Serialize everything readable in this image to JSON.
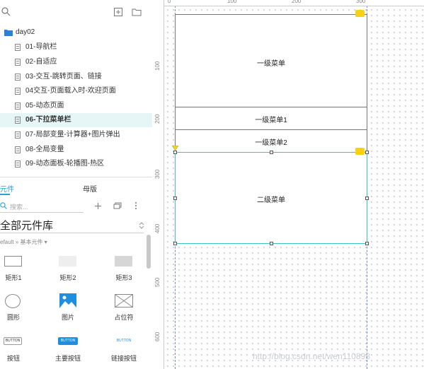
{
  "pages": {
    "folder": "day02",
    "items": [
      {
        "label": "01-导航栏"
      },
      {
        "label": "02-自适应"
      },
      {
        "label": "03-交互-跳转页面、链接"
      },
      {
        "label": "04交互-页面载入时-欢迎页面"
      },
      {
        "label": "05-动态页面"
      },
      {
        "label": "06-下拉菜单栏",
        "selected": true
      },
      {
        "label": "07-局部变量-计算器+图片弹出"
      },
      {
        "label": "08-全局变量"
      },
      {
        "label": "09-动态面板-轮播图-热区"
      }
    ]
  },
  "library": {
    "tab_widgets": "元件",
    "tab_masters": "母版",
    "search_placeholder": "搜索...",
    "title": "全部元件库",
    "breadcrumb": "efault » 基本元件 ▾",
    "widgets": [
      {
        "label": "矩形1",
        "icon": "rectangle-icon"
      },
      {
        "label": "矩形2",
        "icon": "rectangle-gray-icon"
      },
      {
        "label": "矩形3",
        "icon": "rectangle-dark-icon"
      },
      {
        "label": "圆形",
        "icon": "ellipse-icon"
      },
      {
        "label": "图片",
        "icon": "image-icon"
      },
      {
        "label": "占位符",
        "icon": "placeholder-icon"
      },
      {
        "label": "按钮",
        "icon": "button-icon"
      },
      {
        "label": "主要按钮",
        "icon": "primary-button-icon"
      },
      {
        "label": "链接按钮",
        "icon": "link-button-icon"
      }
    ],
    "button_text": "BUTTON"
  },
  "ruler": {
    "x_ticks": [
      "0",
      "100",
      "200",
      "300"
    ],
    "y_ticks": [
      "100",
      "200",
      "300",
      "400",
      "500",
      "600"
    ]
  },
  "canvas": {
    "menu_main": "一级菜单",
    "menu_1": "一级菜单1",
    "menu_2": "一级菜单2",
    "submenu": "二级菜单",
    "bolt": "⚡"
  },
  "watermark": "http://blog.csdn.net/wen110898",
  "colors": {
    "accent": "#2a9fd6",
    "selection": "#3cc4c4",
    "folder": "#2a7fd6",
    "bolt": "#f5d312"
  }
}
